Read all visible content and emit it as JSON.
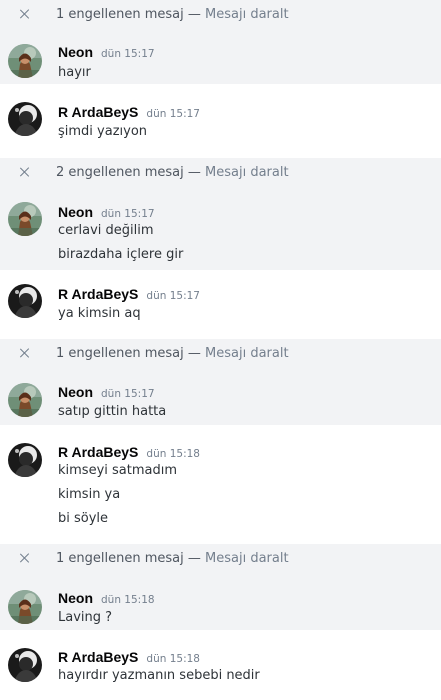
{
  "bar_separator": "—",
  "groups": [
    {
      "blocked": {
        "count_text": "1 engellenen mesaj",
        "collapse_label": "Mesajı daralt"
      },
      "messages": [
        {
          "author": "Neon",
          "timestamp": "dün 15:17",
          "lines": [
            "hayır"
          ]
        },
        {
          "author": "R ArdaBeyS",
          "timestamp": "dün 15:17",
          "lines": [
            "şimdi yazıyon"
          ]
        }
      ]
    },
    {
      "blocked": {
        "count_text": "2 engellenen mesaj",
        "collapse_label": "Mesajı daralt"
      },
      "messages": [
        {
          "author": "Neon",
          "timestamp": "dün 15:17",
          "lines": [
            "cerlavi değilim",
            "birazdaha içlere gir"
          ]
        },
        {
          "author": "R ArdaBeyS",
          "timestamp": "dün 15:17",
          "lines": [
            "ya kimsin aq"
          ]
        }
      ]
    },
    {
      "blocked": {
        "count_text": "1 engellenen mesaj",
        "collapse_label": "Mesajı daralt"
      },
      "messages": [
        {
          "author": "Neon",
          "timestamp": "dün 15:17",
          "lines": [
            "satıp gittin hatta"
          ]
        },
        {
          "author": "R ArdaBeyS",
          "timestamp": "dün 15:18",
          "lines": [
            "kimseyi satmadım",
            "kimsin ya",
            "bi söyle"
          ]
        }
      ]
    },
    {
      "blocked": {
        "count_text": "1 engellenen mesaj",
        "collapse_label": "Mesajı daralt"
      },
      "messages": [
        {
          "author": "Neon",
          "timestamp": "dün 15:18",
          "lines": [
            "Laving ?"
          ]
        },
        {
          "author": "R ArdaBeyS",
          "timestamp": "dün 15:18",
          "lines": [
            "hayırdır yazmanın sebebi nedir"
          ]
        }
      ]
    }
  ],
  "colors": {
    "bar_bg": "#f2f3f5",
    "author": "#060607",
    "timestamp": "#747f8d",
    "text": "#2e3338"
  }
}
